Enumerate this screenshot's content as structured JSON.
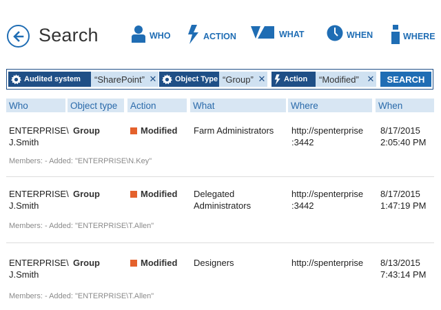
{
  "header": {
    "title": "Search",
    "back_icon": "back-arrow-icon",
    "nav": [
      {
        "label": "WHO",
        "icon": "person-icon"
      },
      {
        "label": "ACTION",
        "icon": "lightning-icon"
      },
      {
        "label": "WHAT",
        "icon": "shapes-icon"
      },
      {
        "label": "WHEN",
        "icon": "clock-icon"
      },
      {
        "label": "WHERE",
        "icon": "info-icon"
      }
    ]
  },
  "filters": [
    {
      "key": "Audited system",
      "key_icon": "gear-icon",
      "value": "“SharePoint”"
    },
    {
      "key": "Object Type",
      "key_icon": "gear-icon",
      "value": "“Group”"
    },
    {
      "key": "Action",
      "key_icon": "lightning-icon",
      "value": "“Modified”"
    }
  ],
  "search_button": "SEARCH",
  "table": {
    "columns": [
      "Who",
      "Object type",
      "Action",
      "What",
      "Where",
      "When"
    ],
    "rows": [
      {
        "who_line1": "ENTERPRISE\\",
        "who_line2": "J.Smith",
        "object_type": "Group",
        "action": "Modified",
        "what_line1": "Farm Administrators",
        "what_line2": "",
        "where_line1": "http://spenterprise",
        "where_line2": ":3442",
        "when_line1": "8/17/2015",
        "when_line2": "2:05:40 PM",
        "members": "Members: - Added: \"ENTERPRISE\\N.Key\""
      },
      {
        "who_line1": "ENTERPRISE\\",
        "who_line2": "J.Smith",
        "object_type": "Group",
        "action": "Modified",
        "what_line1": "Delegated",
        "what_line2": "Administrators",
        "where_line1": "http://spenterprise",
        "where_line2": ":3442",
        "when_line1": "8/17/2015",
        "when_line2": "1:47:19 PM",
        "members": "Members: - Added: \"ENTERPRISE\\T.Allen\""
      },
      {
        "who_line1": "ENTERPRISE\\",
        "who_line2": "J.Smith",
        "object_type": "Group",
        "action": "Modified",
        "what_line1": "Designers",
        "what_line2": "",
        "where_line1": "http://spenterprise",
        "where_line2": "",
        "when_line1": "8/13/2015",
        "when_line2": "7:43:14 PM",
        "members": "Members: - Added: \"ENTERPRISE\\T.Allen\""
      }
    ]
  },
  "colors": {
    "accent": "#1f6db4",
    "dark_accent": "#1f4f86",
    "chip_value_bg": "#cfe1f1",
    "header_bg": "#d8e6f3",
    "action_marker": "#e4612c"
  }
}
